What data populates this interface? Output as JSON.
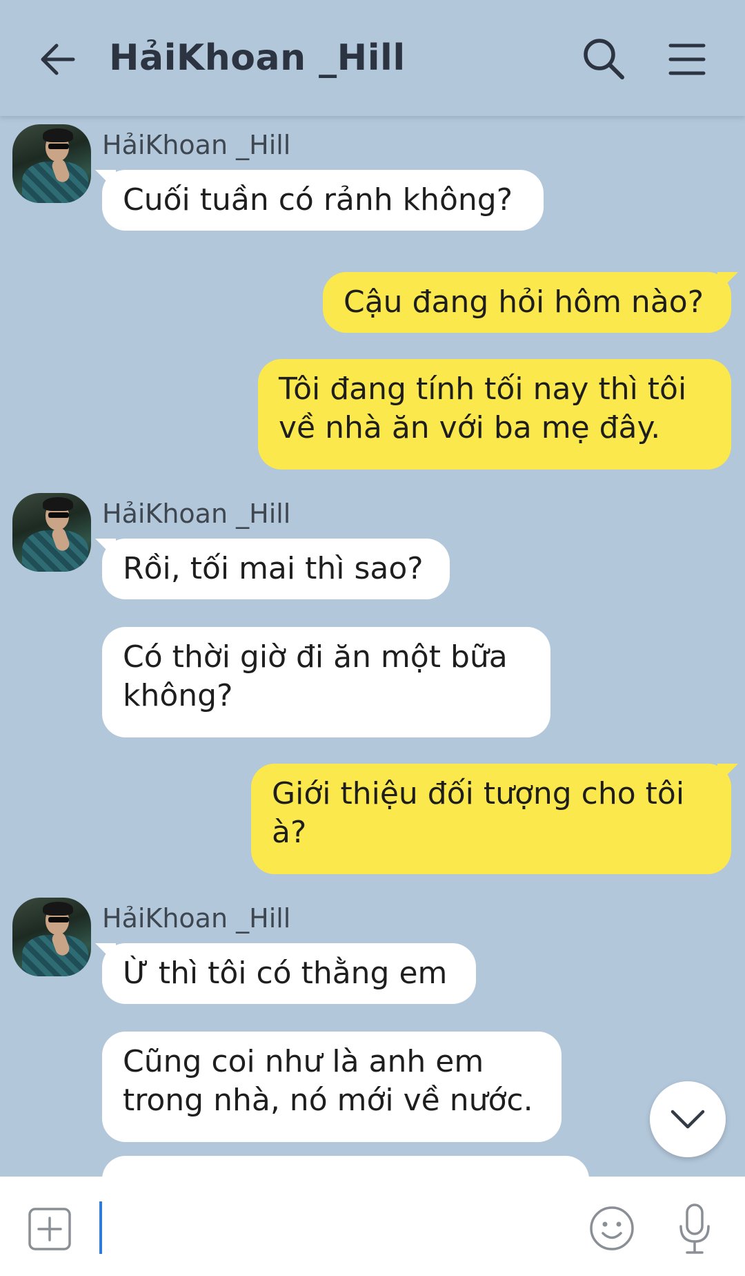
{
  "header": {
    "title": "HảiKhoan _Hill"
  },
  "chat": {
    "groups": [
      {
        "sender": "HảiKhoan _Hill",
        "messages": [
          "Cuối tuần có rảnh không?"
        ]
      },
      {
        "outgoing": [
          "Cậu đang hỏi hôm nào?",
          "Tôi đang tính tối nay thì tôi về nhà ăn với ba mẹ đây."
        ]
      },
      {
        "sender": "HảiKhoan _Hill",
        "messages": [
          "Rồi, tối mai thì sao?",
          "Có thời giờ đi ăn một bữa không?"
        ]
      },
      {
        "outgoing": [
          "Giới thiệu đối tượng cho tôi à?"
        ]
      },
      {
        "sender": "HảiKhoan _Hill",
        "messages": [
          "Ừ thì tôi có thằng em",
          "Cũng coi như là anh em trong nhà, nó mới về nước."
        ]
      }
    ],
    "out_lines": {
      "m2a": "Tôi đang tính tối nay thì tôi",
      "m2b": "về nhà ăn với ba mẹ đây.",
      "m4a": "Có thời giờ đi ăn một bữa",
      "m4b": "không?",
      "m5a": "Giới thiệu đối tượng cho tôi",
      "m5b": "à?",
      "m7a": "Cũng coi như là anh em",
      "m7b": "trong nhà, nó mới về nước."
    }
  },
  "input": {
    "value": ""
  },
  "icons": {
    "back": "arrow-left-icon",
    "search": "search-icon",
    "menu": "hamburger-menu-icon",
    "scroll": "chevron-down-icon",
    "attach": "plus-square-icon",
    "emoji": "smiley-icon",
    "mic": "microphone-icon"
  },
  "colors": {
    "background": "#b2c7da",
    "incoming_bubble": "#ffffff",
    "outgoing_bubble": "#fbe84d",
    "cursor": "#2f7bd8"
  }
}
